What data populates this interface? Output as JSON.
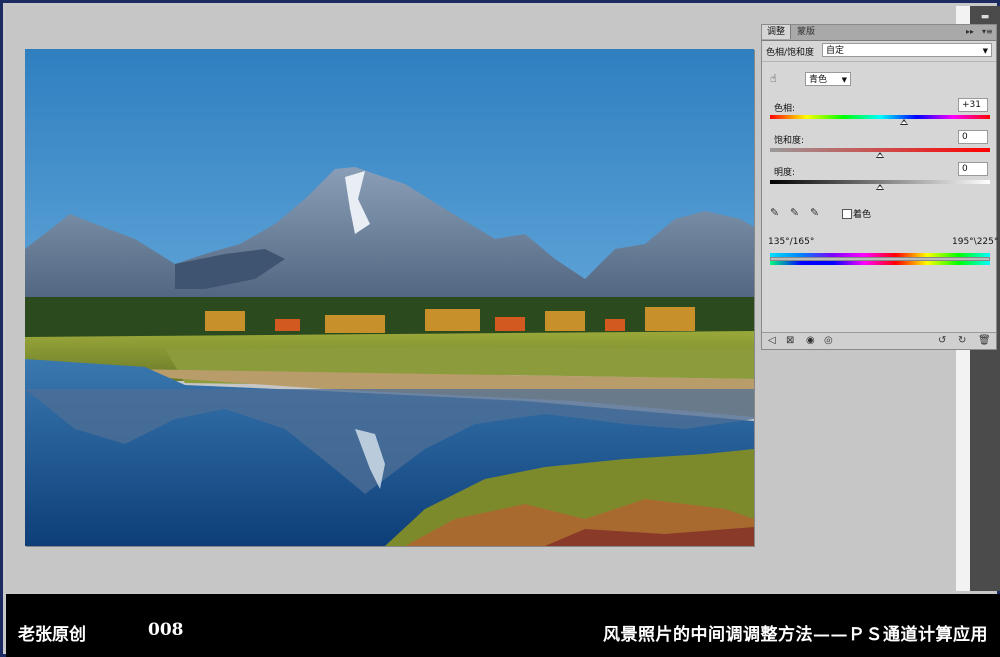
{
  "panel": {
    "tabs": [
      "调整",
      "蒙版"
    ],
    "tab_controls": [
      "▸▸",
      "▾≡"
    ],
    "preset_label": "色相/饱和度",
    "preset_value": "自定",
    "channel_value": "青色",
    "hue_label": "色相:",
    "hue_value": "+31",
    "hue_level": 0.61,
    "saturation_label": "饱和度:",
    "saturation_value": "0",
    "saturation_level": 0.5,
    "lightness_label": "明度:",
    "lightness_value": "0",
    "lightness_level": 0.5,
    "colorize_label": "着色",
    "range_left": "135°/165°",
    "range_right": "195°\\225°"
  },
  "footer": {
    "author": "老张原创",
    "number": "008",
    "title": "风景照片的中间调调整方法——ＰＳ通道计算应用"
  },
  "icons": {
    "hand": "targeted-adjustment-icon",
    "eyedropper": "eyedropper-icon",
    "eyedropper_plus": "eyedropper-plus-icon",
    "eyedropper_minus": "eyedropper-minus-icon"
  }
}
